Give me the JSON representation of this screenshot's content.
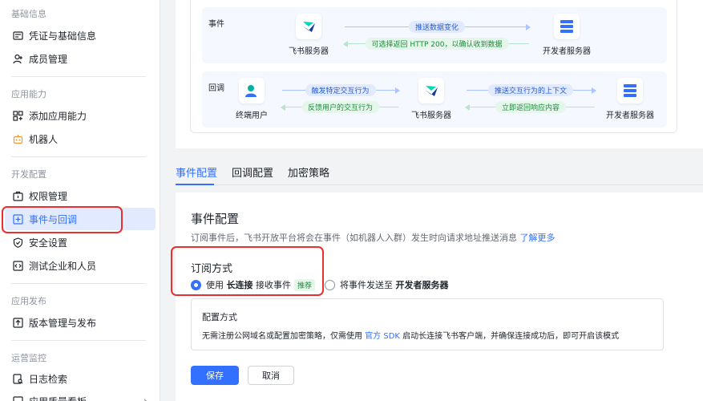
{
  "sidebar": {
    "sections": [
      {
        "title": "基础信息",
        "items": [
          {
            "label": "凭证与基础信息",
            "icon": "credential-icon"
          },
          {
            "label": "成员管理",
            "icon": "user-add-icon"
          }
        ]
      },
      {
        "title": "应用能力",
        "items": [
          {
            "label": "添加应用能力",
            "icon": "apps-icon"
          },
          {
            "label": "机器人",
            "icon": "robot-icon"
          }
        ]
      },
      {
        "title": "开发配置",
        "items": [
          {
            "label": "权限管理",
            "icon": "permission-icon"
          },
          {
            "label": "事件与回调",
            "icon": "event-icon"
          },
          {
            "label": "安全设置",
            "icon": "shield-icon"
          },
          {
            "label": "测试企业和人员",
            "icon": "code-icon"
          }
        ]
      },
      {
        "title": "应用发布",
        "items": [
          {
            "label": "版本管理与发布",
            "icon": "upload-icon"
          }
        ]
      },
      {
        "title": "运营监控",
        "items": [
          {
            "label": "日志检索",
            "icon": "log-icon"
          },
          {
            "label": "应用质量看板",
            "icon": "chart-icon"
          }
        ]
      }
    ],
    "active": "事件与回调"
  },
  "flow": {
    "event_row": {
      "tag": "事件",
      "from": "飞书服务器",
      "to": "开发者服务器",
      "forward": "推送数据变化",
      "back": "可选择返回 HTTP 200，以确认收到数据"
    },
    "callback_row": {
      "tag": "回调",
      "user": "终端用户",
      "server": "飞书服务器",
      "dev": "开发者服务器",
      "forward1": "触发特定交互行为",
      "back1": "反馈用户的交互行为",
      "forward2": "推送交互行为的上下文",
      "back2": "立即返回响应内容"
    }
  },
  "tabs": [
    "事件配置",
    "回调配置",
    "加密策略"
  ],
  "panel": {
    "title": "事件配置",
    "desc": "订阅事件后，飞书开放平台将会在事件（如机器人入群）发生时向请求地址推送消息",
    "desc_link": "了解更多",
    "subscribe_title": "订阅方式",
    "option1_pre": "使用",
    "option1_bold": "长连接",
    "option1_post": "接收事件",
    "option1_badge": "推荐",
    "option2_pre": "将事件发送至",
    "option2_bold": "开发者服务器",
    "config_title": "配置方式",
    "config_pre": "无需注册公网域名或配置加密策略，仅需使用",
    "config_link": "官方 SDK",
    "config_post": "启动长连接飞书客户端，并确保连接成功后，即可开启该模式",
    "save": "保存",
    "cancel": "取消"
  },
  "colors": {
    "accent": "#3370ff",
    "highlight": "#e8302f",
    "green": "#1f8a3c"
  }
}
